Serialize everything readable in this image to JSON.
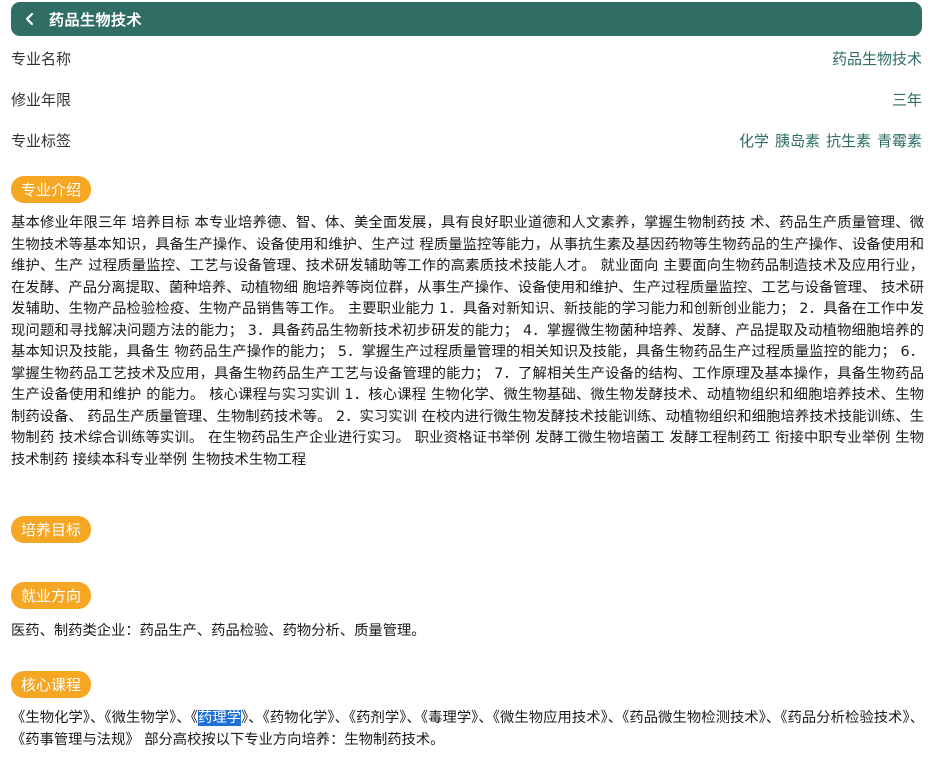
{
  "header": {
    "title": "药品生物技术"
  },
  "info": {
    "name_label": "专业名称",
    "name_value": "药品生物技术",
    "years_label": "修业年限",
    "years_value": "三年",
    "tags_label": "专业标签",
    "tags": [
      "化学",
      "胰岛素",
      "抗生素",
      "青霉素"
    ]
  },
  "sections": {
    "intro_title": "专业介绍",
    "intro_text": "基本修业年限三年 培养目标 本专业培养德、智、体、美全面发展，具有良好职业道德和人文素养，掌握生物制药技 术、药品生产质量管理、微生物技术等基本知识，具备生产操作、设备使用和维护、生产过 程质量监控等能力，从事抗生素及基因药物等生物药品的生产操作、设备使用和维护、生产 过程质量监控、工艺与设备管理、技术研发辅助等工作的高素质技术技能人才。 就业面向 主要面向生物药品制造技术及应用行业，在发酵、产品分离提取、菌种培养、动植物细 胞培养等岗位群，从事生产操作、设备使用和维护、生产过程质量监控、工艺与设备管理、 技术研发辅助、生物产品检验检疫、生物产品销售等工作。 主要职业能力 1．具备对新知识、新技能的学习能力和创新创业能力； 2．具备在工作中发现问题和寻找解决问题方法的能力； 3．具备药品生物新技术初步研发的能力； 4．掌握微生物菌种培养、发酵、产品提取及动植物细胞培养的基本知识及技能，具备生 物药品生产操作的能力； 5．掌握生产过程质量管理的相关知识及技能，具备生物药品生产过程质量监控的能力； 6．掌握生物药品工艺技术及应用，具备生物药品生产工艺与设备管理的能力； 7．了解相关生产设备的结构、工作原理及基本操作，具备生物药品生产设备使用和维护 的能力。 核心课程与实习实训 1．核心课程 生物化学、微生物基础、微生物发酵技术、动植物组织和细胞培养技术、生物制药设备、 药品生产质量管理、生物制药技术等。 2．实习实训 在校内进行微生物发酵技术技能训练、动植物组织和细胞培养技术技能训练、生物制药 技术综合训练等实训。 在生物药品生产企业进行实习。 职业资格证书举例 发酵工微生物培菌工 发酵工程制药工 衔接中职专业举例 生物技术制药 接续本科专业举例 生物技术生物工程",
    "goal_title": "培养目标",
    "career_title": "就业方向",
    "career_text": "医药、制药类企业：药品生产、药品检验、药物分析、质量管理。",
    "courses_title": "核心课程",
    "courses_text_before": "《生物化学》、《微生物学》、《",
    "courses_highlight": "药理学",
    "courses_text_after": "》、《药物化学》、《药剂学》、《毒理学》、《微生物应用技术》、《药品微生物检测技术》、《药品分析检验技术》、《药事管理与法规》 部分高校按以下专业方向培养：生物制药技术。"
  }
}
